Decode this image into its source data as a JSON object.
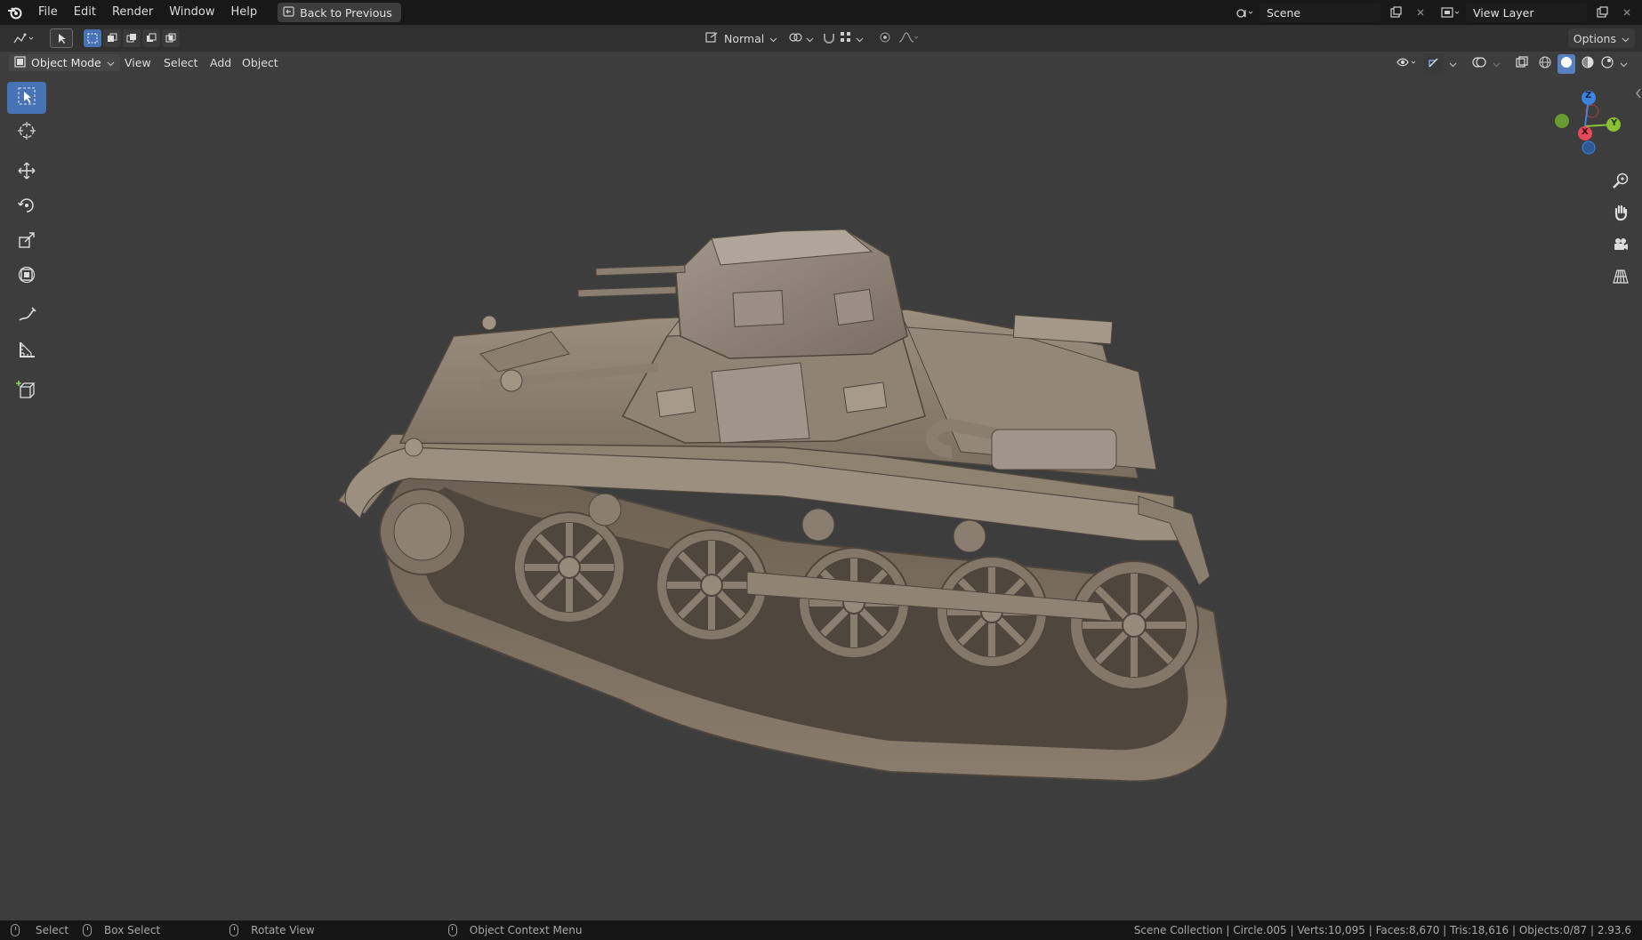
{
  "topbar": {
    "menus": [
      "File",
      "Edit",
      "Render",
      "Window",
      "Help"
    ],
    "back_button": "Back to Previous",
    "scene_name": "Scene",
    "view_layer": "View Layer"
  },
  "tool_header": {
    "transform_orientation": "Normal",
    "options_label": "Options"
  },
  "viewport_header": {
    "mode": "Object Mode",
    "menus": [
      "View",
      "Select",
      "Add",
      "Object"
    ]
  },
  "gizmo": {
    "z_label": "Z",
    "y_label": "Y",
    "x_label": "X",
    "colors": {
      "x": "#e54a5a",
      "y": "#8bbf35",
      "z": "#3d84e0"
    }
  },
  "statusbar": {
    "select": "Select",
    "box_select": "Box Select",
    "rotate_view": "Rotate View",
    "context_menu": "Object Context Menu",
    "stats": "Scene Collection | Circle.005 | Verts:10,095 | Faces:8,670 | Tris:18,616 | Objects:0/87 | 2.93.6"
  },
  "colors": {
    "accent": "#4772b3",
    "viewport_bg": "#3d3d3d",
    "model": "#8a7d6d"
  }
}
